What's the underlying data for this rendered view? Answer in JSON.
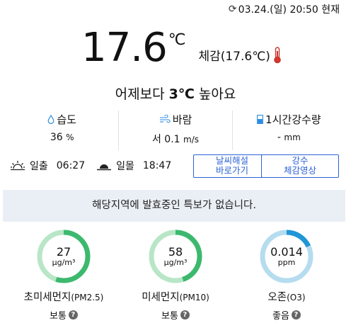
{
  "updated": {
    "text": "03.24.(일) 20:50 현재"
  },
  "current": {
    "temp": "17.6",
    "unit": "℃",
    "feels_label": "체감(17.6℃)"
  },
  "compare": {
    "prefix": "어제보다 ",
    "value": "3℃",
    "suffix": " 높아요"
  },
  "stats": {
    "humidity": {
      "label": "습도",
      "value": "36",
      "unit": "%"
    },
    "wind": {
      "label": "바람",
      "value": "서 0.1",
      "unit": "m/s"
    },
    "rain": {
      "label": "1시간강수량",
      "value": "-",
      "unit": "mm"
    }
  },
  "sun": {
    "rise_label": "일출",
    "rise_time": "06:27",
    "set_label": "일몰",
    "set_time": "18:47"
  },
  "buttons": {
    "weather_line1": "날씨해설",
    "weather_line2": "바로가기",
    "rain_line1": "강수",
    "rain_line2": "체감영상"
  },
  "alert": {
    "text": "해당지역에 발효중인 특보가 없습니다."
  },
  "air": {
    "pm25": {
      "value": "27",
      "unit": "μg/m³",
      "name": "초미세먼지",
      "sub": "(PM2.5)",
      "grade": "보통",
      "level": 0.55
    },
    "pm10": {
      "value": "58",
      "unit": "μg/m³",
      "name": "미세먼지",
      "sub": "(PM10)",
      "grade": "보통",
      "level": 0.45
    },
    "o3": {
      "value": "0.014",
      "unit": "ppm",
      "name": "오존",
      "sub": "(O3)",
      "grade": "좋음",
      "level": 0.18
    }
  },
  "colors": {
    "good": "#1e96d7",
    "normal": "#3cb96e",
    "normal_track": "#b8e6c6",
    "good_track": "#b5dcef",
    "button": "#2b63d6"
  }
}
